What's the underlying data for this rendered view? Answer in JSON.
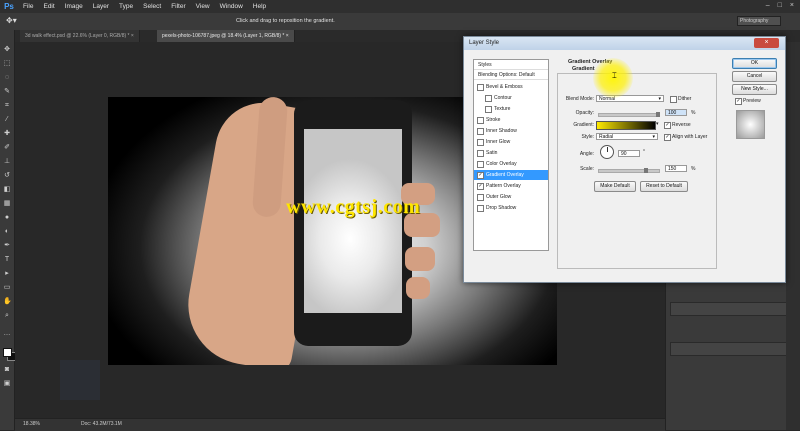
{
  "app": {
    "logo": "Ps"
  },
  "menu": [
    "File",
    "Edit",
    "Image",
    "Layer",
    "Type",
    "Select",
    "Filter",
    "View",
    "Window",
    "Help"
  ],
  "window_controls": [
    "–",
    "□",
    "×"
  ],
  "options_bar": {
    "hint": "Click and drag to reposition the gradient.",
    "workspace": "Photography"
  },
  "tabs": [
    {
      "label": "3d walk effect.psd @ 22.6% (Layer 0, RGB/8) *",
      "close": "×"
    },
    {
      "label": "pexels-photo-106787.jpeg @ 18.4% (Layer 1, RGB/8) *",
      "close": "×"
    }
  ],
  "watermark": "www.cgtsj.com",
  "status": {
    "zoom": "18.38%",
    "doc": "Doc: 43.2M/73.1M"
  },
  "dialog": {
    "title": "Layer Style",
    "styles_header": "Styles",
    "blending_options": "Blending Options: Default",
    "style_items": [
      {
        "label": "Bevel & Emboss",
        "checked": false,
        "indent": false
      },
      {
        "label": "Contour",
        "checked": false,
        "indent": true
      },
      {
        "label": "Texture",
        "checked": false,
        "indent": true
      },
      {
        "label": "Stroke",
        "checked": false,
        "indent": false
      },
      {
        "label": "Inner Shadow",
        "checked": false,
        "indent": false
      },
      {
        "label": "Inner Glow",
        "checked": false,
        "indent": false
      },
      {
        "label": "Satin",
        "checked": false,
        "indent": false
      },
      {
        "label": "Color Overlay",
        "checked": false,
        "indent": false
      },
      {
        "label": "Gradient Overlay",
        "checked": true,
        "indent": false,
        "selected": true
      },
      {
        "label": "Pattern Overlay",
        "checked": true,
        "indent": false
      },
      {
        "label": "Outer Glow",
        "checked": false,
        "indent": false
      },
      {
        "label": "Drop Shadow",
        "checked": false,
        "indent": false
      }
    ],
    "section_title": "Gradient Overlay",
    "subsection_title": "Gradient",
    "blend_mode_label": "Blend Mode:",
    "blend_mode_value": "Normal",
    "dither_label": "Dither",
    "opacity_label": "Opacity:",
    "opacity_value": "100",
    "percent": "%",
    "gradient_label": "Gradient:",
    "reverse_label": "Reverse",
    "style_label": "Style:",
    "style_value": "Radial",
    "align_label": "Align with Layer",
    "angle_label": "Angle:",
    "angle_value": "90",
    "degree": "°",
    "scale_label": "Scale:",
    "scale_value": "150",
    "make_default": "Make Default",
    "reset_default": "Reset to Default",
    "ok": "OK",
    "cancel": "Cancel",
    "new_style": "New Style...",
    "preview_label": "Preview"
  }
}
